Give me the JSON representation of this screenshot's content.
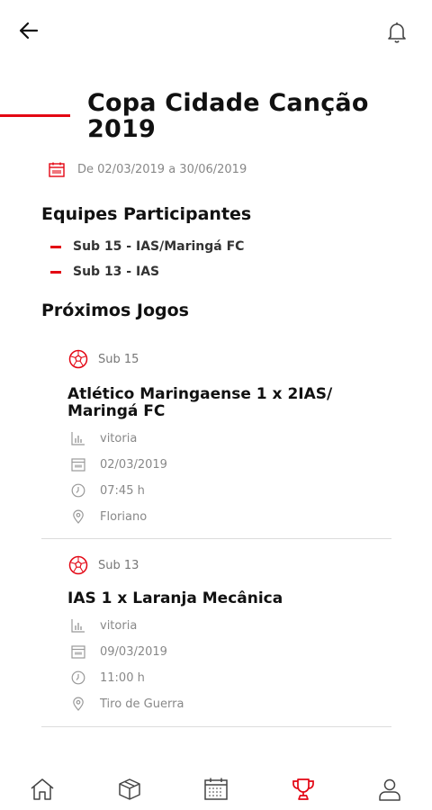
{
  "header": {
    "back_icon": "arrow-left-icon",
    "bell_icon": "bell-icon"
  },
  "page": {
    "title": "Copa Cidade Canção 2019",
    "date_range": "De 02/03/2019 a 30/06/2019",
    "accent_color": "#e30613"
  },
  "teams": {
    "section_title": "Equipes Participantes",
    "items": [
      "Sub 15 - IAS/Maringá FC",
      "Sub 13 - IAS"
    ]
  },
  "games": {
    "section_title": "Próximos Jogos",
    "items": [
      {
        "category": "Sub 15",
        "match": "Atlético Maringaense 1 x  2IAS/ Maringá FC",
        "result": "vitoria",
        "date": "02/03/2019",
        "time": "07:45 h",
        "location": "Floriano"
      },
      {
        "category": "Sub 13",
        "match": "IAS 1 x  Laranja Mecânica",
        "result": "vitoria",
        "date": "09/03/2019",
        "time": "11:00 h",
        "location": "Tiro de Guerra"
      }
    ]
  },
  "bottom_nav": {
    "items": [
      "home-icon",
      "box-icon",
      "calendar-icon",
      "trophy-icon",
      "user-icon"
    ],
    "active": "trophy-icon"
  }
}
